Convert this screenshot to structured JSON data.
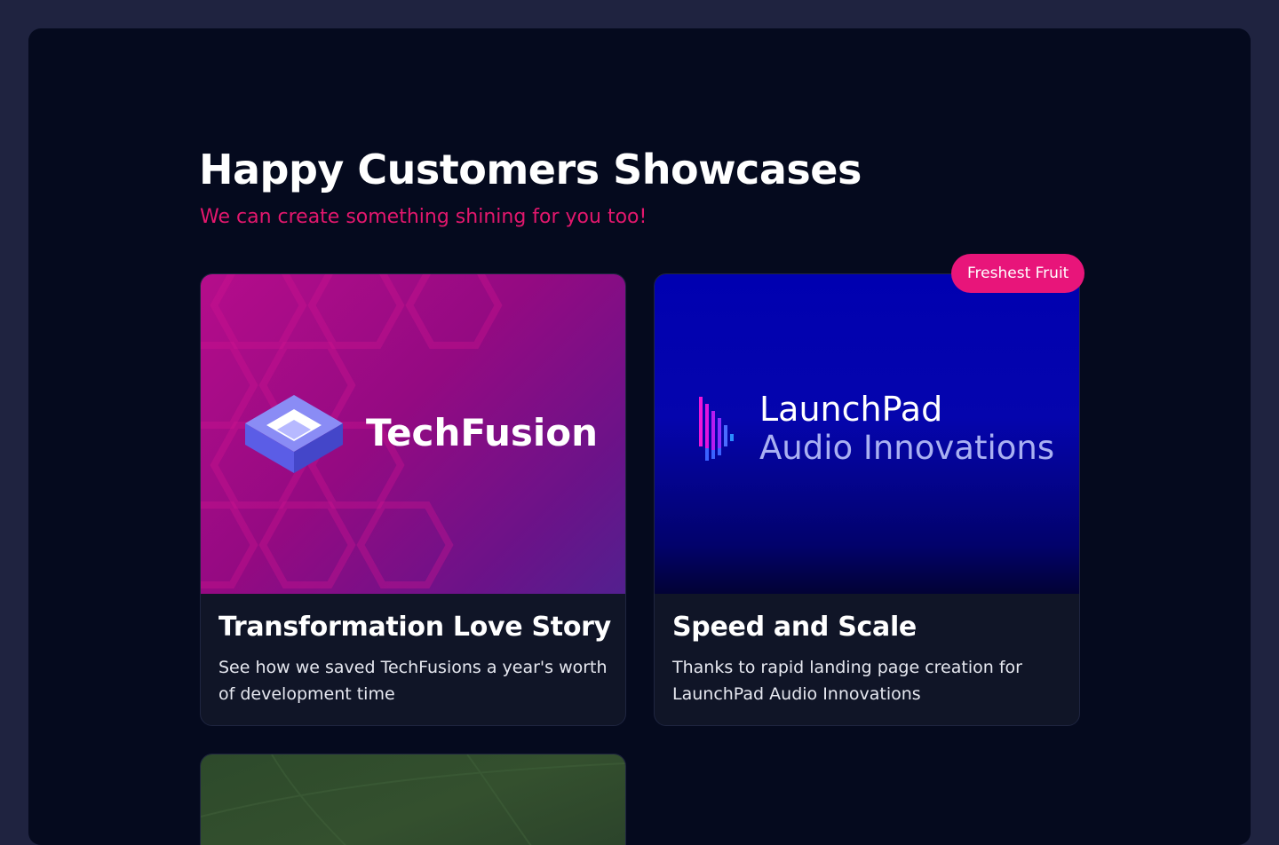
{
  "section": {
    "title": "Happy Customers Showcases",
    "subtitle": "We can create something shining for you too!"
  },
  "cards": [
    {
      "brand": "TechFusion",
      "title": "Transformation Love Story",
      "description": "See how we saved TechFusions a year's worth of development time"
    },
    {
      "brand_line1": "LaunchPad",
      "brand_line2": "Audio Innovations",
      "badge": "Freshest Fruit",
      "title": "Speed and Scale",
      "description": "Thanks to rapid landing page creation for LaunchPad Audio Innovations"
    }
  ],
  "colors": {
    "page_bg": "#1f2340",
    "panel_bg": "#050a1e",
    "accent": "#e3176d",
    "card_bg": "#101527"
  }
}
